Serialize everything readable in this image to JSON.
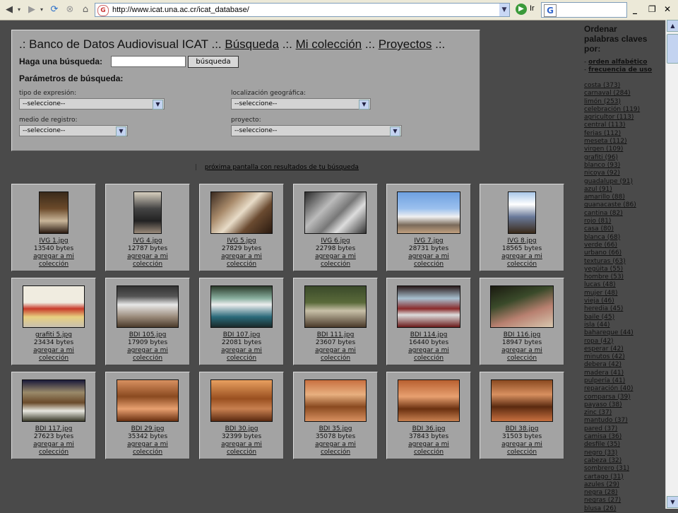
{
  "browser": {
    "url": "http://www.icat.una.ac.cr/icat_database/",
    "go_label": "Ir",
    "window_controls": [
      "_",
      "❐",
      "✕"
    ]
  },
  "search": {
    "title_prefix": ".: Banco de Datos Audiovisual ICAT .:.",
    "link_busqueda": "Búsqueda",
    "sep1": ".:.",
    "link_coleccion": "Mi colección",
    "sep2": ".:.",
    "link_proyectos": "Proyectos",
    "sep3": ".:.",
    "query_label": "Haga una búsqueda:",
    "query_value": "",
    "button_label": "búsqueda",
    "params_label": "Parámetros de búsqueda:",
    "fields": {
      "tipo_label": "tipo de expresión:",
      "tipo_value": "--seleccione--",
      "localizacion_label": "localización geográfica:",
      "localizacion_value": "--seleccione--",
      "medio_label": "medio de registro:",
      "medio_value": "--seleccione--",
      "proyecto_label": "proyecto:",
      "proyecto_value": "--seleccione--"
    }
  },
  "pagination": {
    "separator": "|",
    "next_label": "próxima pantalla con resultados de tu búsqueda"
  },
  "add_label_1": "agregar a mi",
  "add_label_2": "colección",
  "results": [
    {
      "name": "IVG 1.jpg",
      "size": "13540 bytes"
    },
    {
      "name": "IVG 4.jpg",
      "size": "12787 bytes"
    },
    {
      "name": "IVG 5.jpg",
      "size": "27829 bytes"
    },
    {
      "name": "IVG 6.jpg",
      "size": "22798 bytes"
    },
    {
      "name": "IVG 7.jpg",
      "size": "28731 bytes"
    },
    {
      "name": "IVG 8.jpg",
      "size": "18565 bytes"
    },
    {
      "name": "grafiti 5.jpg",
      "size": "23434 bytes"
    },
    {
      "name": "BDI 105.jpg",
      "size": "17909 bytes"
    },
    {
      "name": "BDI 107.jpg",
      "size": "22081 bytes"
    },
    {
      "name": "BDI 111.jpg",
      "size": "23607 bytes"
    },
    {
      "name": "BDI 114.jpg",
      "size": "16440 bytes"
    },
    {
      "name": "BDI 116.jpg",
      "size": "18947 bytes"
    },
    {
      "name": "BDI 117.jpg",
      "size": "27623 bytes"
    },
    {
      "name": "BDI 29.jpg",
      "size": "35342 bytes"
    },
    {
      "name": "BDI 30.jpg",
      "size": "32399 bytes"
    },
    {
      "name": "BDI 35.jpg",
      "size": "35078 bytes"
    },
    {
      "name": "BDI 36.jpg",
      "size": "37843 bytes"
    },
    {
      "name": "BDI 38.jpg",
      "size": "31503 bytes"
    }
  ],
  "sidebar": {
    "title_1": "Ordenar",
    "title_2": "palabras claves",
    "title_3": "por:",
    "sort_alpha": "orden alfabético",
    "sort_freq": "frecuencia de uso",
    "keywords": [
      "costa (373)",
      "carnaval (284)",
      "limón (253)",
      "celebración (119)",
      "agricultor (113)",
      "central (113)",
      "ferias (112)",
      "meseta (112)",
      "virgen (109)",
      "grafiti (96)",
      "blanco (93)",
      "nicoya (92)",
      "guadalupe (91)",
      "azul (91)",
      "amarillo (88)",
      "guanacaste (86)",
      "cantina (82)",
      "rojo (81)",
      "casa (80)",
      "blanca (68)",
      "verde (66)",
      "urbano (66)",
      "texturas (63)",
      "yegüita (55)",
      "hombre (53)",
      "lucas (48)",
      "mujer (48)",
      "vieja (46)",
      "heredia (45)",
      "baile (45)",
      "isla (44)",
      "bahareque (44)",
      "ropa (42)",
      "esperar (42)",
      "minutos (42)",
      "debera (42)",
      "madera (41)",
      "pulpería (41)",
      "reparación (40)",
      "comparsa (39)",
      "payaso (38)",
      "zinc (37)",
      "mantudo (37)",
      "pared (37)",
      "camisa (36)",
      "desfile (35)",
      "negro (33)",
      "cabeza (32)",
      "sombrero (31)",
      "cartago (31)",
      "azules (29)",
      "negra (28)",
      "negras (27)",
      "blusa (26)"
    ]
  }
}
